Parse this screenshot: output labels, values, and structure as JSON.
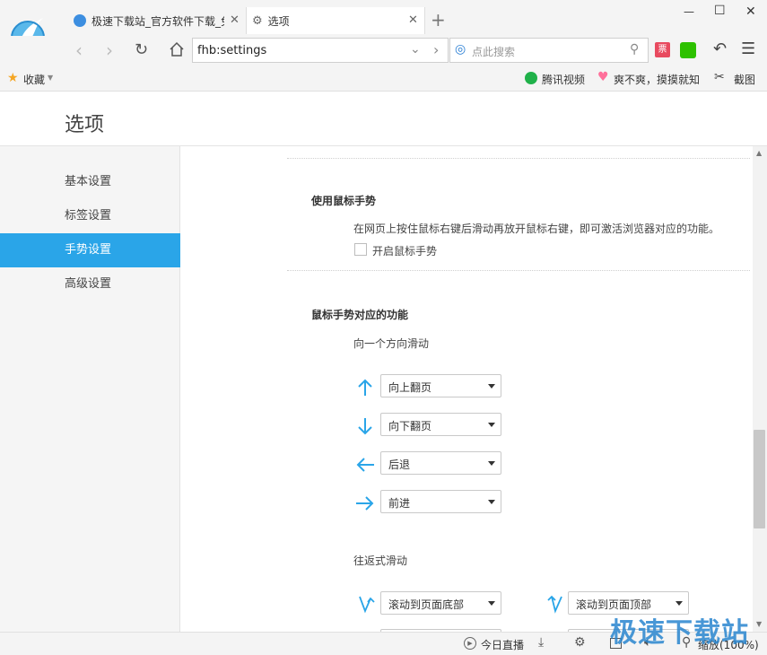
{
  "tabs": [
    {
      "label": "极速下载站_官方软件下载_免"
    },
    {
      "label": "选项"
    }
  ],
  "window": {
    "minimize": "—",
    "maximize": "☐",
    "close": "✕"
  },
  "address": {
    "value": "fhb:settings"
  },
  "search": {
    "placeholder": "点此搜索"
  },
  "bookmarks": {
    "favorites": "收藏",
    "items": [
      "腾讯视频",
      "爽不爽，摸摸就知"
    ],
    "screenshot": "截图"
  },
  "page": {
    "title": "选项"
  },
  "sidebar": {
    "items": [
      {
        "label": "基本设置"
      },
      {
        "label": "标签设置"
      },
      {
        "label": "手势设置",
        "active": true
      },
      {
        "label": "高级设置"
      }
    ]
  },
  "mouse_gesture": {
    "heading": "使用鼠标手势",
    "description": "在网页上按住鼠标右键后滑动再放开鼠标右键，即可激活浏览器对应的功能。",
    "checkbox_label": "开启鼠标手势",
    "checked": false
  },
  "functions": {
    "heading": "鼠标手势对应的功能",
    "one_direction_label": "向一个方向滑动",
    "directions": [
      {
        "icon": "arrow-up-icon",
        "value": "向上翻页"
      },
      {
        "icon": "arrow-down-icon",
        "value": "向下翻页"
      },
      {
        "icon": "arrow-left-icon",
        "value": "后退"
      },
      {
        "icon": "arrow-right-icon",
        "value": "前进"
      }
    ],
    "round_trip_label": "往返式滑动",
    "round_trip": [
      {
        "icon": "down-up-gesture-icon",
        "value": "滚动到页面底部"
      },
      {
        "icon": "up-down-gesture-icon",
        "value": "滚动到页面顶部"
      }
    ]
  },
  "statusbar": {
    "live": "今日直播",
    "zoom": "缩放(100%)"
  },
  "watermark": "极速下载站",
  "colors": {
    "accent": "#2aa5e8",
    "arrow": "#2aa5e8"
  }
}
